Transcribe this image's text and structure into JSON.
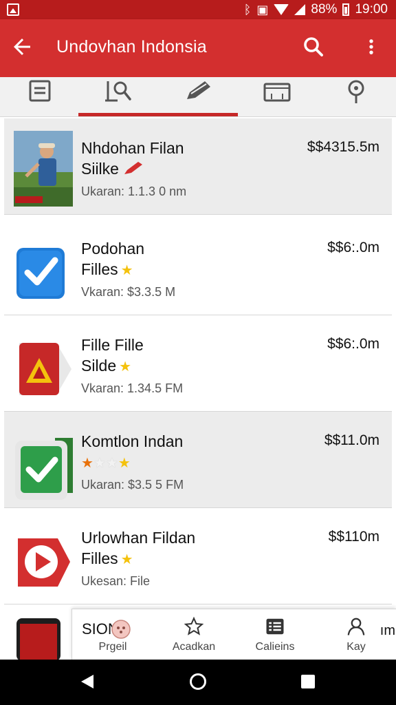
{
  "status_bar": {
    "battery_text": "88%",
    "time": "19:00"
  },
  "app_bar": {
    "title": "Undovhan Indonsia",
    "icons": [
      "arrow-back-icon",
      "search-icon",
      "more-vert-icon"
    ]
  },
  "tabs": [
    {
      "icon": "document-icon",
      "selected": false
    },
    {
      "icon": "search-files-icon",
      "selected": true
    },
    {
      "icon": "edit-pen-icon",
      "selected": false
    },
    {
      "icon": "folder-icon",
      "selected": false
    },
    {
      "icon": "location-pin-icon",
      "selected": false
    }
  ],
  "items": [
    {
      "name_line1": "Nhdohan Filan",
      "name_line2": "Siilke",
      "subtitle": "Ukaran: 1.1.3 0 nm",
      "price": "$$4315.5m",
      "thumb_icon": "person-photo-icon"
    },
    {
      "name_line1": "Podohan",
      "name_line2": "Filles",
      "subtitle": "Vkaran: $3.3.5 M",
      "price": "$$6:.0m",
      "thumb_icon": "blue-checkmark-icon"
    },
    {
      "name_line1": "Fille Fille",
      "name_line2": "Silde",
      "subtitle": "Vkaran: 1.34.5 FM",
      "price": "$$6:.0m",
      "thumb_icon": "red-warning-icon"
    },
    {
      "name_line1": "Komtlon Indan",
      "name_line2": "",
      "subtitle": "Ukaran: $3.5 5 FM",
      "price": "$$11.0m",
      "thumb_icon": "green-checkmark-icon"
    },
    {
      "name_line1": "Urlowhan Fildan",
      "name_line2": "Filles",
      "subtitle": "Ukesan: File",
      "price": "$$110m",
      "thumb_icon": "red-play-icon"
    }
  ],
  "bottom_nav": {
    "heading": "SION",
    "items": [
      {
        "label": "Prgeil",
        "icon": "profile-icon"
      },
      {
        "label": "Acadkan",
        "icon": "star-outline-icon"
      },
      {
        "label": "Calieins",
        "icon": "list-icon"
      },
      {
        "label": "Kay",
        "icon": "person-outline-icon"
      }
    ],
    "extra_text": "ım"
  },
  "colors": {
    "status_bar": "#b71c1c",
    "app_bar": "#d32f2f",
    "tab_indicator": "#c62828",
    "star": "#f4c20d"
  }
}
